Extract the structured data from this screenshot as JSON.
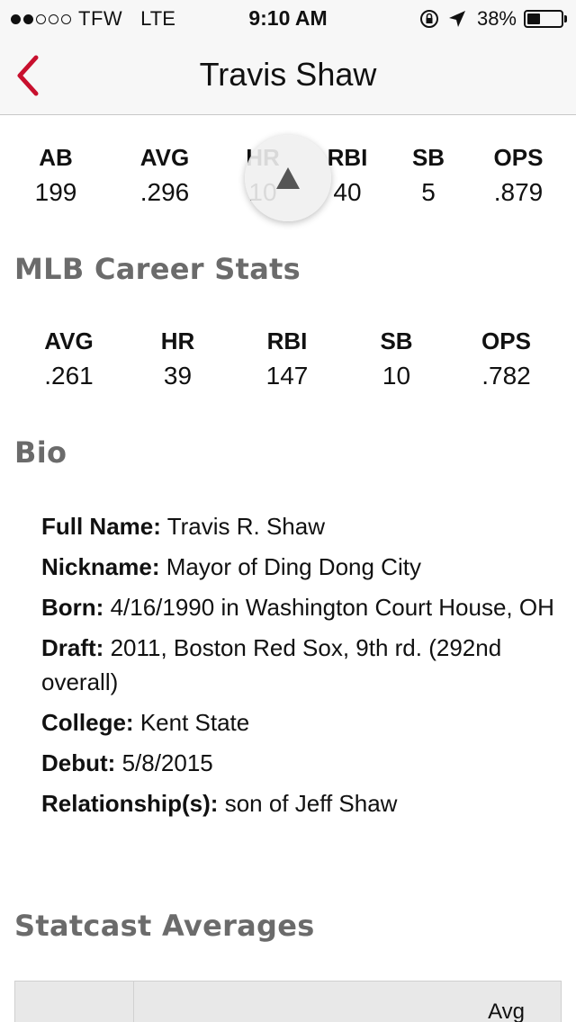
{
  "status_bar": {
    "carrier": "TFW",
    "network": "LTE",
    "time": "9:10 AM",
    "battery": "38%",
    "battery_fraction": 0.38,
    "signal_dots_filled": 2,
    "signal_dots_total": 5
  },
  "nav": {
    "title": "Travis Shaw",
    "accent_color": "#c8102e"
  },
  "season_stats": [
    {
      "label": "AB",
      "value": "199"
    },
    {
      "label": "AVG",
      "value": ".296"
    },
    {
      "label": "HR",
      "value": "10"
    },
    {
      "label": "RBI",
      "value": "40"
    },
    {
      "label": "SB",
      "value": "5"
    },
    {
      "label": "OPS",
      "value": ".879"
    }
  ],
  "career": {
    "title": "MLB Career Stats",
    "stats": [
      {
        "label": "AVG",
        "value": ".261"
      },
      {
        "label": "HR",
        "value": "39"
      },
      {
        "label": "RBI",
        "value": "147"
      },
      {
        "label": "SB",
        "value": "10"
      },
      {
        "label": "OPS",
        "value": ".782"
      }
    ]
  },
  "bio": {
    "title": "Bio",
    "items": [
      {
        "key": "Full Name:",
        "value": "Travis R. Shaw"
      },
      {
        "key": "Nickname:",
        "value": "Mayor of Ding Dong City"
      },
      {
        "key": "Born:",
        "value": "4/16/1990 in Washington Court House, OH"
      },
      {
        "key": "Draft:",
        "value": "2011, Boston Red Sox, 9th rd. (292nd overall)"
      },
      {
        "key": "College:",
        "value": "Kent State"
      },
      {
        "key": "Debut:",
        "value": "5/8/2015"
      },
      {
        "key": "Relationship(s):",
        "value": "son of Jeff Shaw"
      }
    ]
  },
  "statcast": {
    "title": "Statcast Averages",
    "header_avg": "Avg"
  },
  "icons": {
    "back": "chevron-left-icon",
    "scroll_top": "triangle-up-icon",
    "lock": "orientation-lock-icon",
    "location": "location-arrow-icon"
  }
}
